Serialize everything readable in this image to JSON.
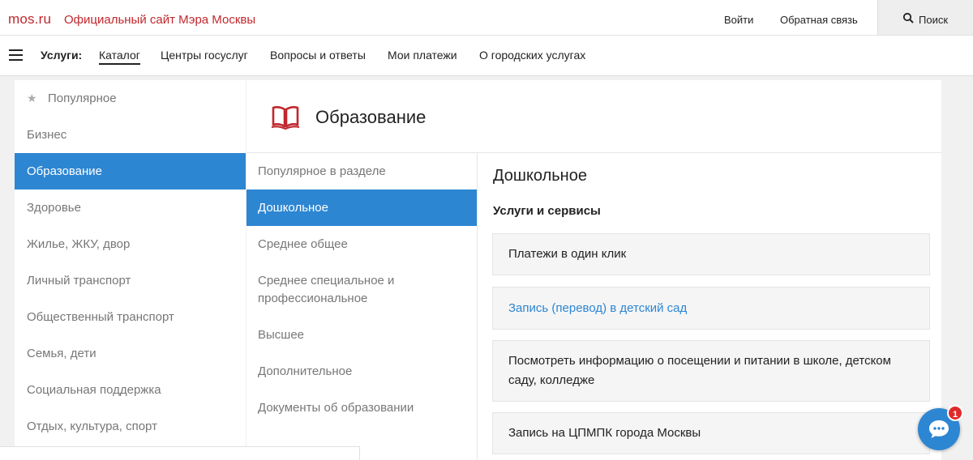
{
  "header": {
    "logo": "mos.ru",
    "site_title": "Официальный сайт Мэра Москвы",
    "login": "Войти",
    "feedback": "Обратная связь",
    "search": "Поиск"
  },
  "nav": {
    "heading": "Услуги:",
    "items": [
      "Каталог",
      "Центры госуслуг",
      "Вопросы и ответы",
      "Мои платежи",
      "О городских услугах"
    ]
  },
  "categories": [
    "Популярное",
    "Бизнес",
    "Образование",
    "Здоровье",
    "Жилье, ЖКУ, двор",
    "Личный транспорт",
    "Общественный транспорт",
    "Семья, дети",
    "Социальная поддержка",
    "Отдых, культура, спорт"
  ],
  "section": {
    "title": "Образование",
    "subsections": [
      "Популярное в разделе",
      "Дошкольное",
      "Среднее общее",
      "Среднее специальное и профессиональное",
      "Высшее",
      "Дополнительное",
      "Документы об образовании"
    ]
  },
  "detail": {
    "title": "Дошкольное",
    "subtitle": "Услуги и сервисы",
    "cards": [
      "Платежи в один клик",
      "Запись (перевод) в детский сад",
      "Посмотреть информацию о посещении и питании в школе, детском саду, колледже",
      "Запись на ЦПМПК города Москвы"
    ]
  },
  "chat": {
    "badge": "1"
  },
  "colors": {
    "brand_red": "#c1272d",
    "accent_blue": "#2d86d2"
  }
}
